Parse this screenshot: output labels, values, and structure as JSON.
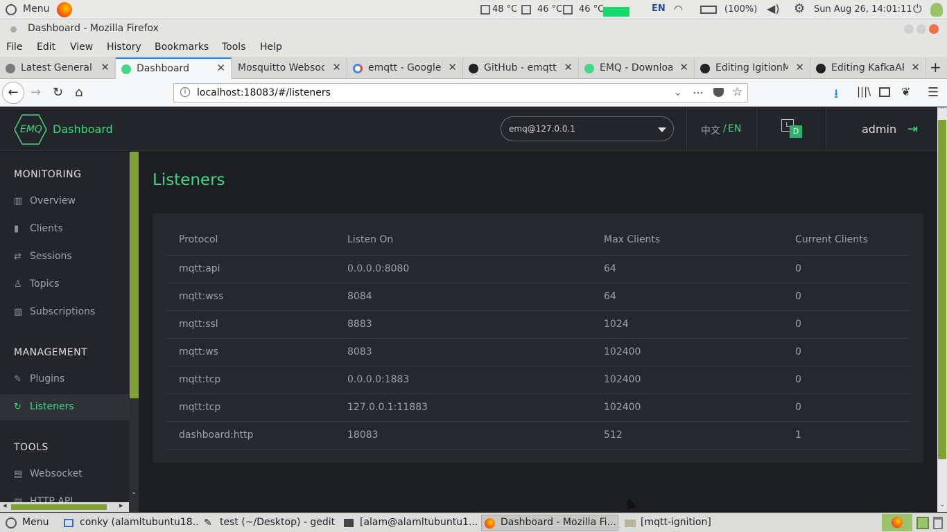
{
  "system_bar": {
    "menu_label": "Menu",
    "temps": [
      "48 °C",
      "46 °C",
      "46 °C"
    ],
    "lang": "EN",
    "battery": "(100%)",
    "datetime": "Sun Aug 26, 14:01:11"
  },
  "window": {
    "title": "Dashboard - Mozilla Firefox"
  },
  "menubar": {
    "items": [
      "File",
      "Edit",
      "View",
      "History",
      "Bookmarks",
      "Tools",
      "Help"
    ]
  },
  "tabs": [
    {
      "label": "Latest General",
      "active": false,
      "icon_color": "#7c7c7c"
    },
    {
      "label": "Dashboard",
      "active": true,
      "icon_color": "#42d885"
    },
    {
      "label": "Mosquitto Websoc",
      "active": false,
      "icon_color": "#d9d9d7"
    },
    {
      "label": "emqtt - Google",
      "active": false,
      "icon_color": "#4285f4"
    },
    {
      "label": "GitHub - emqtt/",
      "active": false,
      "icon_color": "#222222"
    },
    {
      "label": "EMQ - Downloac",
      "active": false,
      "icon_color": "#42d885"
    },
    {
      "label": "Editing IgitionM",
      "active": false,
      "icon_color": "#222222"
    },
    {
      "label": "Editing KafkaAP",
      "active": false,
      "icon_color": "#222222"
    }
  ],
  "navbar": {
    "url": "localhost:18083/#/listeners"
  },
  "app": {
    "logo_text": "EMQ",
    "brand": "Dashboard",
    "node_select": "emq@127.0.0.1",
    "lang_zh": "中文",
    "lang_sep": "/",
    "lang_en": "EN",
    "theme_letters": [
      "L",
      "D"
    ],
    "user": "admin",
    "colors": {
      "accent": "#42d885",
      "sidebar_bar": "#7fa136",
      "bg": "#1c1e22"
    }
  },
  "sidebar": {
    "monitoring_title": "MONITORING",
    "monitoring": [
      {
        "label": "Overview",
        "icon": "bar-chart-icon",
        "glyph": "▥"
      },
      {
        "label": "Clients",
        "icon": "device-icon",
        "glyph": "▮"
      },
      {
        "label": "Sessions",
        "icon": "swap-icon",
        "glyph": "⇄"
      },
      {
        "label": "Topics",
        "icon": "topic-icon",
        "glyph": "♙"
      },
      {
        "label": "Subscriptions",
        "icon": "rss-icon",
        "glyph": "▧"
      }
    ],
    "management_title": "MANAGEMENT",
    "management": [
      {
        "label": "Plugins",
        "icon": "plug-icon",
        "glyph": "✎",
        "active": false
      },
      {
        "label": "Listeners",
        "icon": "refresh-icon",
        "glyph": "↻",
        "active": true
      }
    ],
    "tools_title": "TOOLS",
    "tools": [
      {
        "label": "Websocket",
        "icon": "html5-icon",
        "glyph": "▤"
      },
      {
        "label": "HTTP API",
        "icon": "api-icon",
        "glyph": "▤"
      }
    ]
  },
  "listeners": {
    "page_title": "Listeners",
    "headers": [
      "Protocol",
      "Listen On",
      "Max Clients",
      "Current Clients"
    ],
    "rows": [
      [
        "mqtt:api",
        "0.0.0.0:8080",
        "64",
        "0"
      ],
      [
        "mqtt:wss",
        "8084",
        "64",
        "0"
      ],
      [
        "mqtt:ssl",
        "8883",
        "1024",
        "0"
      ],
      [
        "mqtt:ws",
        "8083",
        "102400",
        "0"
      ],
      [
        "mqtt:tcp",
        "0.0.0.0:1883",
        "102400",
        "0"
      ],
      [
        "mqtt:tcp",
        "127.0.0.1:11883",
        "102400",
        "0"
      ],
      [
        "dashboard:http",
        "18083",
        "512",
        "1"
      ]
    ]
  },
  "taskbar": {
    "menu_label": "Menu",
    "items": [
      "conky (alamltubuntu18...",
      "test (~/Desktop) - gedit",
      "[alam@alamltubuntu1...",
      "Dashboard - Mozilla Fi...",
      "[mqtt-ignition]"
    ]
  }
}
